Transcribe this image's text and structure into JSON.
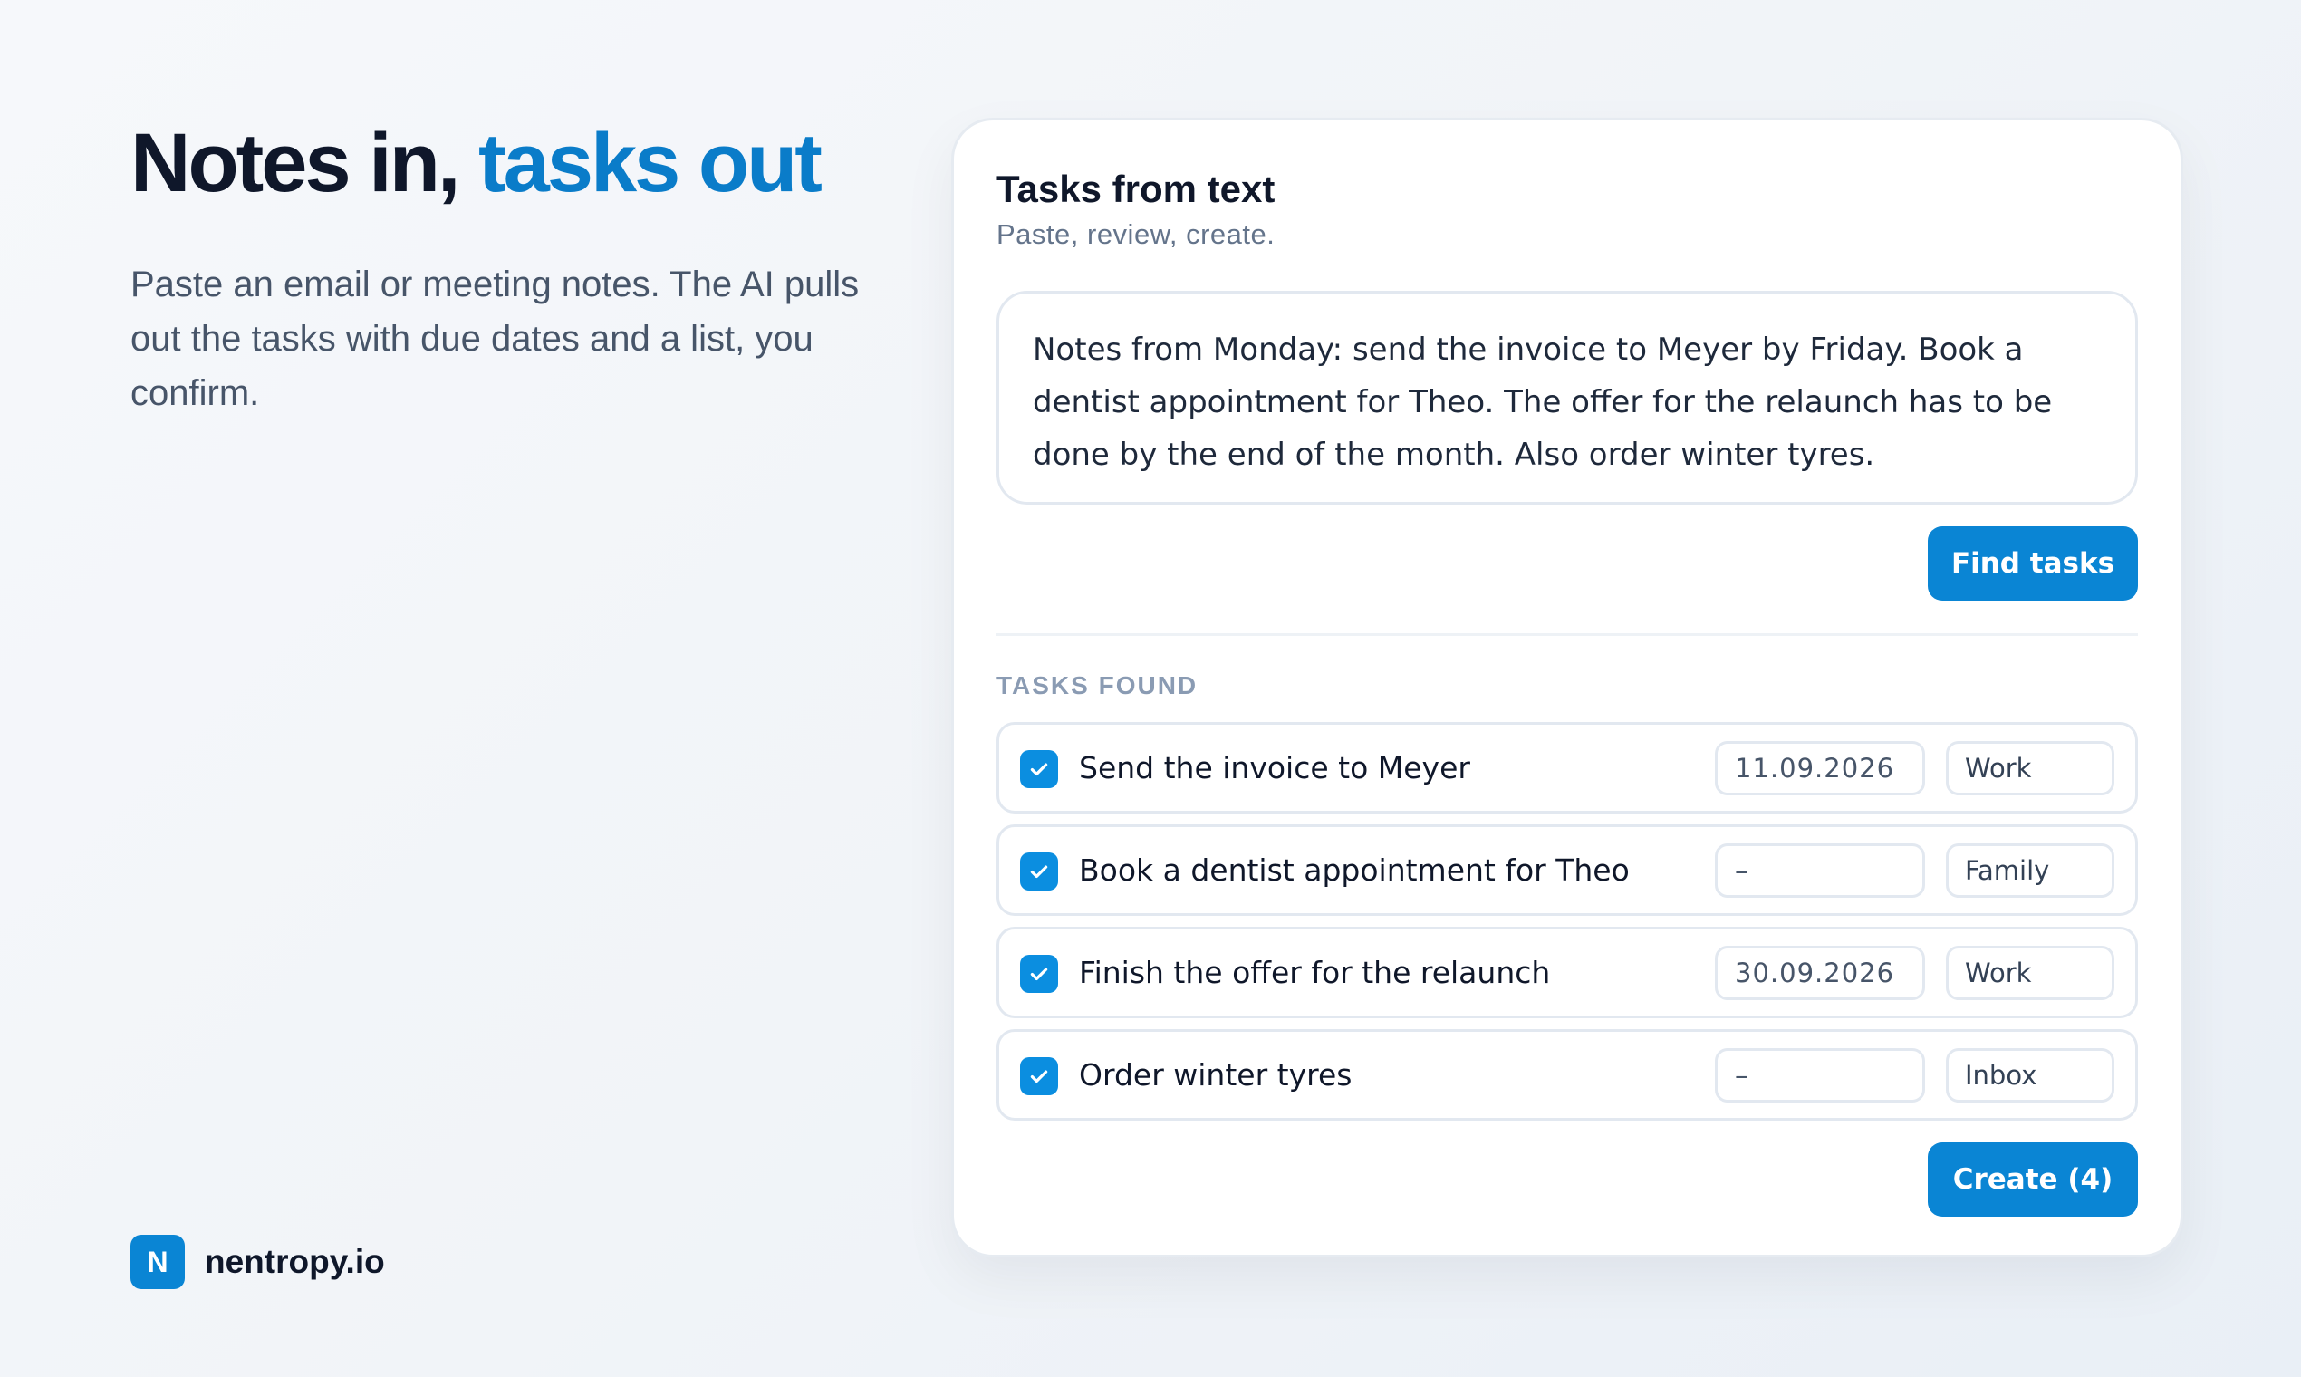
{
  "hero": {
    "title_main": "Notes in, ",
    "title_accent": "tasks out",
    "subtitle": "Paste an email or meeting notes. The AI pulls out the tasks with due dates and a list, you confirm."
  },
  "brand": {
    "mark": "N",
    "name": "nentropy.io"
  },
  "card": {
    "title": "Tasks from text",
    "subtitle": "Paste, review, create.",
    "notes_text": "Notes from Monday: send the invoice to Meyer by Friday. Book a dentist appointment for Theo. The offer for the relaunch has to be done by the end of the month. Also order winter tyres.",
    "find_button": "Find tasks",
    "section_label": "TASKS FOUND",
    "tasks": [
      {
        "title": "Send the invoice to Meyer",
        "due": "11.09.2026",
        "list": "Work",
        "checked": true
      },
      {
        "title": "Book a dentist appointment for Theo",
        "due": "–",
        "list": "Family",
        "checked": true
      },
      {
        "title": "Finish the offer for the relaunch",
        "due": "30.09.2026",
        "list": "Work",
        "checked": true
      },
      {
        "title": "Order winter tyres",
        "due": "–",
        "list": "Inbox",
        "checked": true
      }
    ],
    "create_button": "Create (4)"
  },
  "colors": {
    "accent": "#0a85d4",
    "accent_text": "#0a7cc9",
    "checkbox": "#0b8ee0"
  },
  "icons": {
    "checkbox": "check-icon"
  }
}
